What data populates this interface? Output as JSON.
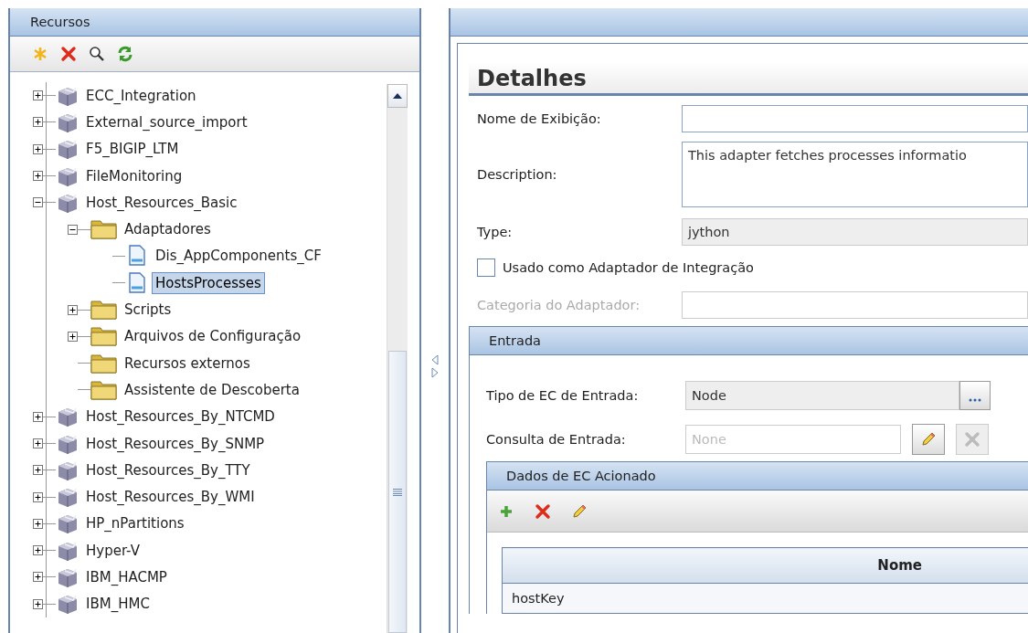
{
  "resources_panel": {
    "title": "Recursos",
    "toolbar": [
      {
        "kind": "new"
      },
      {
        "kind": "delete"
      },
      {
        "kind": "search"
      },
      {
        "kind": "refresh"
      }
    ],
    "tree": [
      {
        "label": "ECC_Integration",
        "kind": "package",
        "expanded": false,
        "selected": false
      },
      {
        "label": "External_source_import",
        "kind": "package",
        "expanded": false,
        "selected": false
      },
      {
        "label": "F5_BIGIP_LTM",
        "kind": "package",
        "expanded": false,
        "selected": false
      },
      {
        "label": "FileMonitoring",
        "kind": "package",
        "expanded": false,
        "selected": false
      },
      {
        "label": "Host_Resources_Basic",
        "kind": "package",
        "expanded": true,
        "selected": false,
        "children": [
          {
            "label": "Adaptadores",
            "kind": "folder",
            "expanded": true,
            "selected": false,
            "children": [
              {
                "label": "Dis_AppComponents_CF",
                "kind": "file",
                "selected": false
              },
              {
                "label": "HostsProcesses",
                "kind": "file",
                "selected": true
              }
            ]
          },
          {
            "label": "Scripts",
            "kind": "folder",
            "expanded": false,
            "selected": false
          },
          {
            "label": "Arquivos de Configuração",
            "kind": "folder",
            "expanded": false,
            "selected": false
          },
          {
            "label": "Recursos externos",
            "kind": "folder",
            "selected": false
          },
          {
            "label": "Assistente de Descoberta",
            "kind": "folder",
            "selected": false
          }
        ]
      },
      {
        "label": "Host_Resources_By_NTCMD",
        "kind": "package",
        "expanded": false,
        "selected": false
      },
      {
        "label": "Host_Resources_By_SNMP",
        "kind": "package",
        "expanded": false,
        "selected": false
      },
      {
        "label": "Host_Resources_By_TTY",
        "kind": "package",
        "expanded": false,
        "selected": false
      },
      {
        "label": "Host_Resources_By_WMI",
        "kind": "package",
        "expanded": false,
        "selected": false
      },
      {
        "label": "HP_nPartitions",
        "kind": "package",
        "expanded": false,
        "selected": false
      },
      {
        "label": "Hyper-V",
        "kind": "package",
        "expanded": false,
        "selected": false
      },
      {
        "label": "IBM_HACMP",
        "kind": "package",
        "expanded": false,
        "selected": false
      },
      {
        "label": "IBM_HMC",
        "kind": "package",
        "expanded": false,
        "selected": false
      }
    ]
  },
  "details": {
    "heading": "Detalhes",
    "fields": [
      {
        "label": "Nome de Exibição:",
        "kind": "text",
        "disabled": false
      },
      {
        "label": "Description:",
        "kind": "textarea",
        "value": "This adapter fetches processes informatio",
        "disabled": false
      },
      {
        "label": "Type:",
        "kind": "readonly",
        "value": "jython",
        "disabled": false
      },
      {
        "label": "Usado como Adaptador de Integração",
        "kind": "checkbox",
        "checked": false
      },
      {
        "label": "Categoria do Adaptador:",
        "kind": "text",
        "disabled": true
      }
    ],
    "input_section": {
      "title": "Entrada",
      "ci_type": {
        "label": "Tipo de EC de Entrada:",
        "value": "Node"
      },
      "query": {
        "label": "Consulta de Entrada:",
        "placeholder": "None",
        "delete_disabled": true
      },
      "triggered_data": {
        "title": "Dados de EC Acionado",
        "toolbar": [
          {
            "kind": "add"
          },
          {
            "kind": "delete"
          },
          {
            "kind": "edit"
          }
        ],
        "columns": [
          "Nome"
        ],
        "rows": [
          [
            "hostKey"
          ]
        ]
      }
    }
  }
}
